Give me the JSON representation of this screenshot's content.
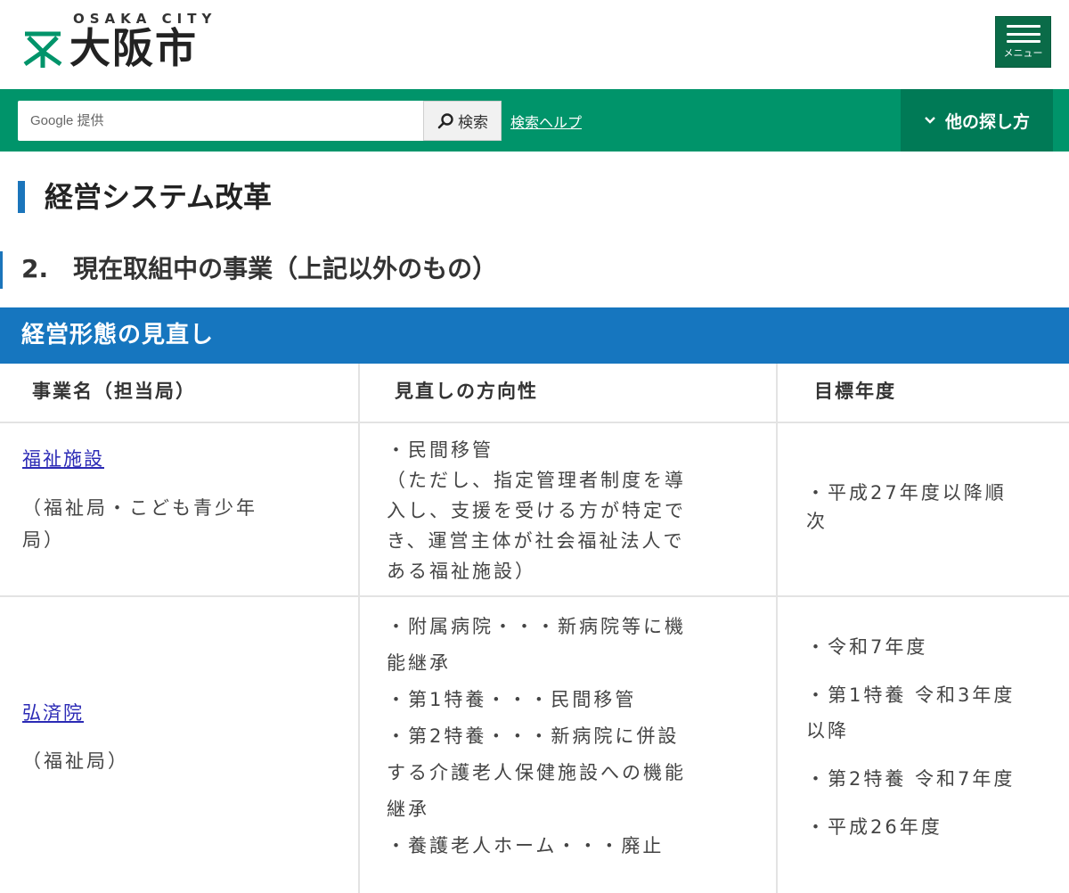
{
  "header": {
    "logo_sub": "OSAKA CITY",
    "logo_text": "大阪市",
    "menu_label": "メニュー"
  },
  "search": {
    "placeholder": "Google 提供",
    "button_label": "検索",
    "help_link": "検索ヘルプ",
    "other_label": "他の探し方"
  },
  "page": {
    "title": "経営システム改革",
    "section_title": "2.　現在取組中の事業（上記以外のもの）",
    "band_title": "経営形態の見直し"
  },
  "table": {
    "headers": [
      "事業名（担当局）",
      "見直しの方向性",
      "目標年度"
    ],
    "rows": [
      {
        "name_link": "福祉施設",
        "bureau_lines": [
          "（福祉局・こども青少年",
          "局）"
        ],
        "direction_lines": [
          "・民間移管",
          "（ただし、指定管理者制度を導",
          "入し、支援を受ける方が特定で",
          "き、運営主体が社会福祉法人で",
          "ある福祉施設）"
        ],
        "target_lines": [
          "・平成27年度以降順",
          "次"
        ]
      },
      {
        "name_link": "弘済院",
        "bureau_lines": [
          "（福祉局）"
        ],
        "direction_lines": [
          "・附属病院・・・新病院等に機",
          "能継承",
          "・第1特養・・・民間移管",
          "・第2特養・・・新病院に併設",
          "する介護老人保健施設への機能",
          "継承",
          "・養護老人ホーム・・・廃止"
        ],
        "target_lines": [
          "・令和7年度",
          "・第1特養 令和3年度",
          "以降",
          "・第2特養 令和7年度",
          "・平成26年度"
        ]
      }
    ]
  },
  "colors": {
    "brand_green": "#00946a",
    "menu_green": "#0a6b48",
    "accent_blue": "#1676bf",
    "link_blue": "#2b2ab5"
  }
}
